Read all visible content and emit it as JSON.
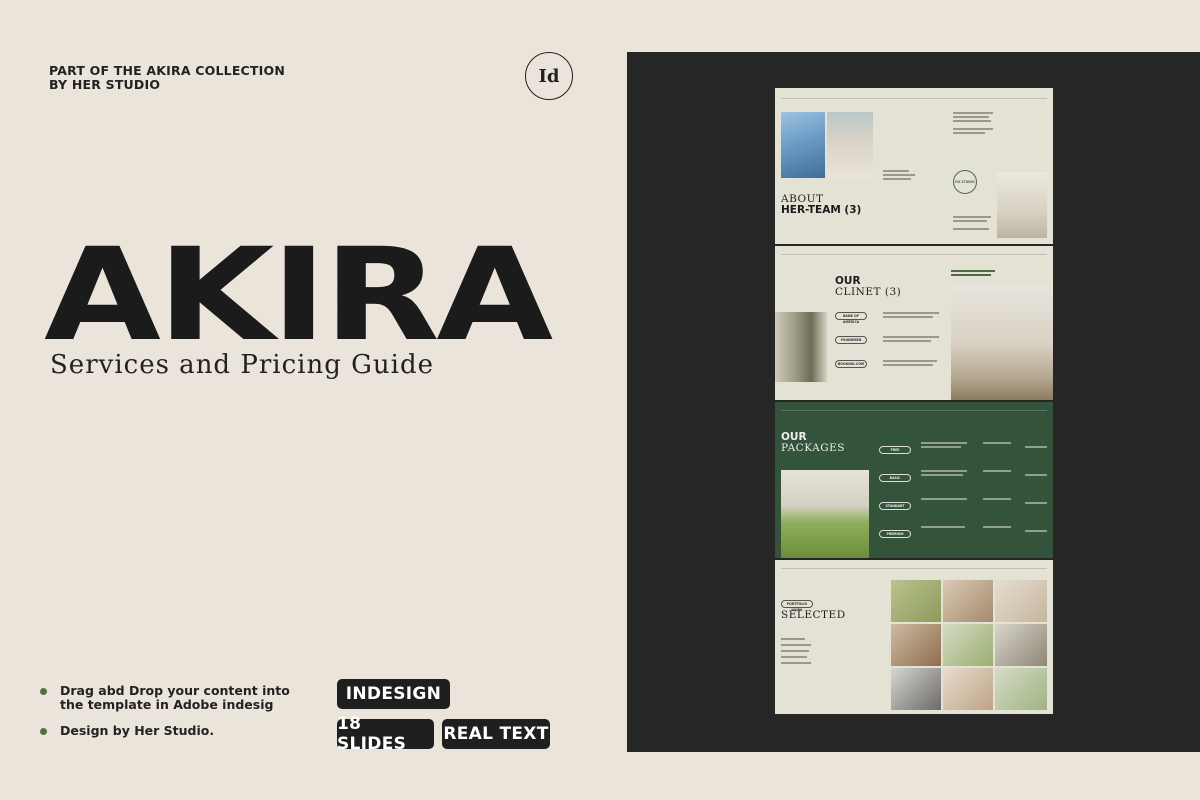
{
  "collection": {
    "line1": "PART OF THE AKIRA COLLECTION",
    "line2": "BY HER STUDIO"
  },
  "badge": {
    "label": "Id"
  },
  "brand": {
    "name": "AKIRA",
    "subtitle": "Services and Pricing Guide"
  },
  "features": [
    {
      "text": "Drag abd Drop your content into the template in Adobe indesig"
    },
    {
      "text": "Design by Her Studio."
    }
  ],
  "tags": {
    "indesign": "INDESIGN",
    "slides": "18 SLIDES",
    "text": "REAL TEXT"
  },
  "preview": {
    "team": {
      "about": "ABOUT",
      "title": "HER-TEAM (3)",
      "stamp": "HS STUDIO"
    },
    "client": {
      "our": "OUR",
      "title": "CLINET (3)",
      "items": [
        "BANK OF AMERICA",
        "YOUNGMEN",
        "BOOKING.COM"
      ]
    },
    "packages": {
      "our": "OUR",
      "title": "PACKAGES",
      "items": [
        "FREE",
        "BASIC",
        "STANDART",
        "PREMIUM"
      ]
    },
    "selected": {
      "tag": "PORTFOLIO WORK",
      "title": "SELECTED"
    }
  },
  "colors": {
    "background": "#ebe4da",
    "preview_bg": "#262626",
    "green": "#33533a",
    "paper": "#e4e1d5",
    "ink": "#1b1b1b"
  }
}
